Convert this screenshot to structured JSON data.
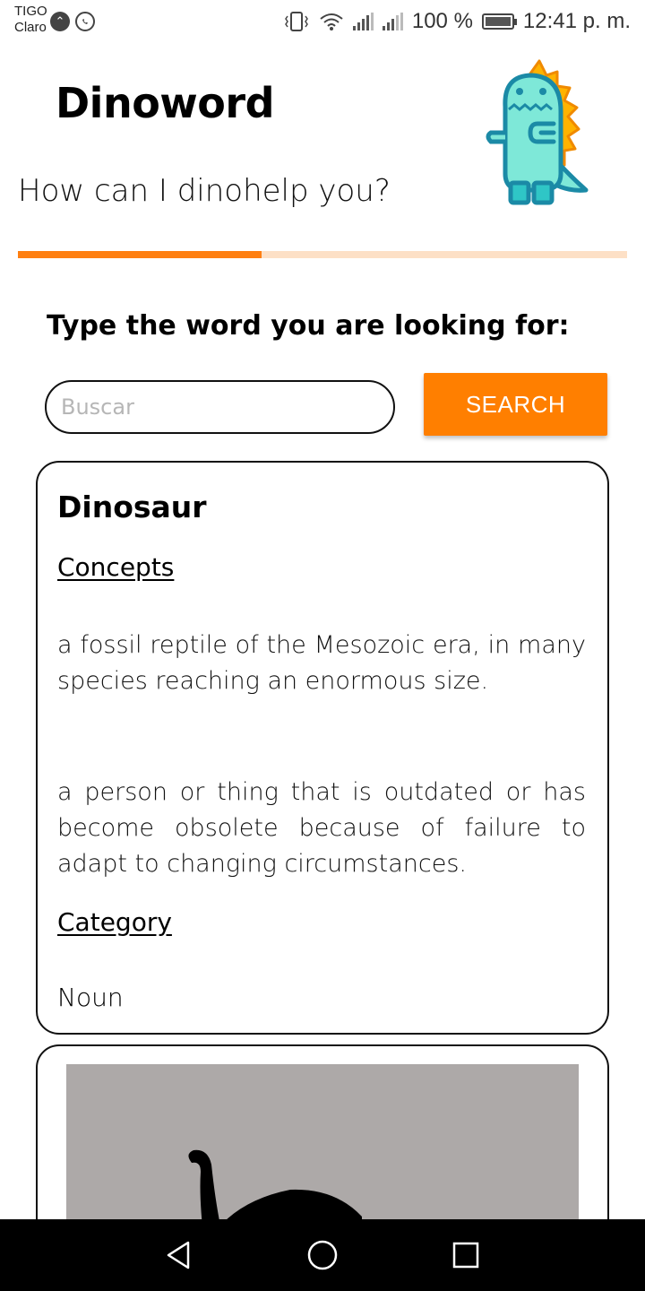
{
  "status_bar": {
    "carrier_line1": "TIGO",
    "carrier_line2": "Claro",
    "battery": "100 %",
    "time": "12:41 p. m.",
    "icons": [
      "arrow-up-circle-icon",
      "whatsapp-icon",
      "vibrate-icon",
      "wifi-icon",
      "signal-icon",
      "signal-icon",
      "battery-icon"
    ]
  },
  "header": {
    "title": "Dinoword",
    "tagline": "How can I dinohelp you?",
    "logo": "dino-mascot-icon"
  },
  "progress": {
    "value": 0.4
  },
  "search": {
    "prompt": "Type the word you are looking for:",
    "placeholder": "Buscar",
    "value": "",
    "button_label": "SEARCH"
  },
  "result": {
    "word": "Dinosaur",
    "concepts_heading": "Concepts",
    "definitions": [
      "a fossil reptile of the Mesozoic era, in many species reaching an enormous size.",
      "a person or thing that is outdated or has become obsolete because of failure to adapt to changing circumstances."
    ],
    "category_heading": "Category",
    "category": "Noun"
  },
  "image_card": {
    "image": "dinosaur-silhouette"
  },
  "nav": {
    "icons": [
      "back-icon",
      "home-icon",
      "recents-icon"
    ]
  },
  "colors": {
    "accent": "#ff7f00",
    "progress_track": "#fde0c6",
    "image_bg": "#ada9a8",
    "mascot": "#7ee8d8",
    "mascot_spikes": "#ffb300"
  }
}
